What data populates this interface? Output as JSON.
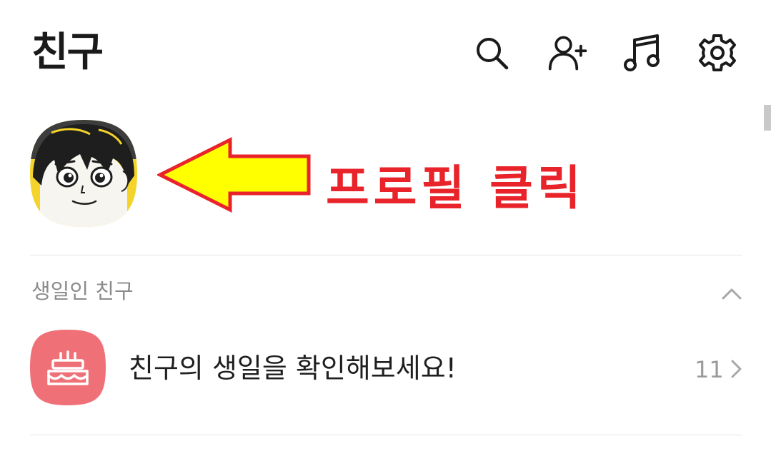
{
  "header": {
    "title": "친구",
    "icons": [
      "search-icon",
      "add-friend-icon",
      "music-icon",
      "settings-icon"
    ]
  },
  "profile": {
    "avatar": "cartoon-boy-avatar"
  },
  "annotation": {
    "text": "프로필 클릭",
    "color": "#e8232a",
    "arrow_fill": "#ffff00"
  },
  "birthday_section": {
    "title": "생일인 친구",
    "toggle_icon": "chevron-up-icon",
    "item": {
      "icon": "cake-icon",
      "icon_bg": "#f07077",
      "label": "친구의 생일을 확인해보세요!",
      "count": "11",
      "chevron": "chevron-right-icon"
    }
  }
}
